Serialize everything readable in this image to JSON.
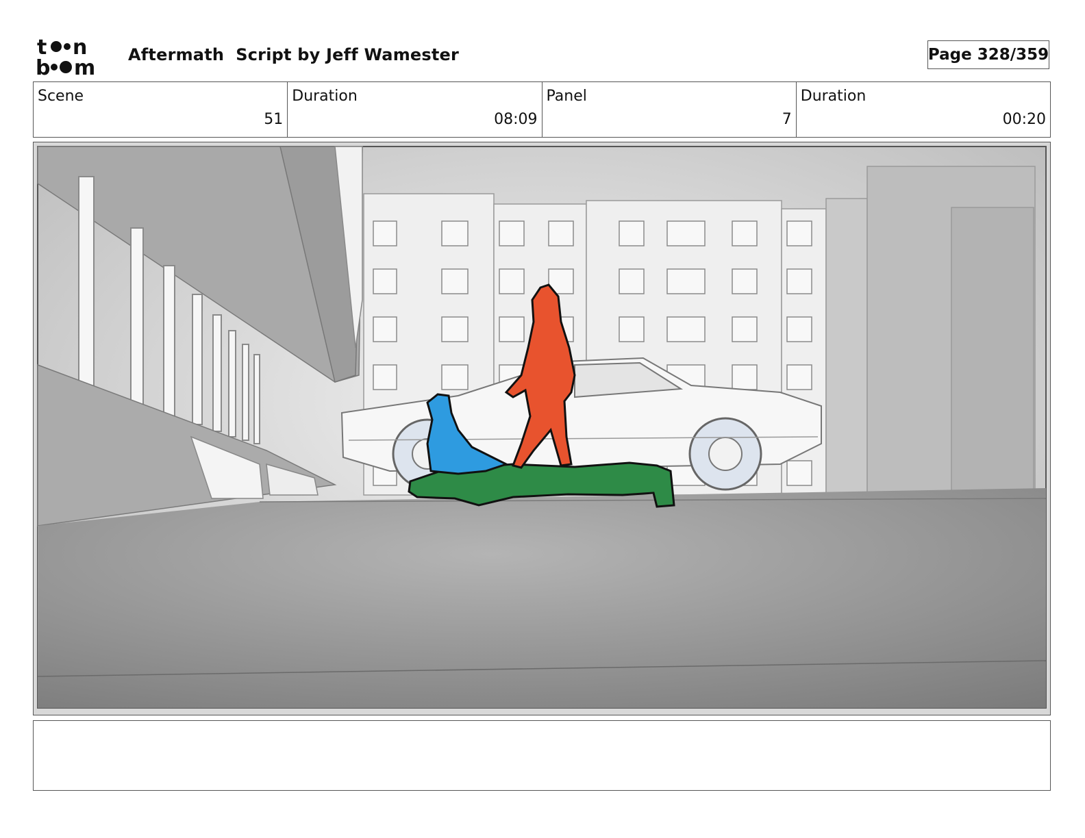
{
  "header": {
    "logo_name": "toonboom-logo",
    "title": "Aftermath  Script by Jeff Wamester",
    "page_label": "Page 328/359"
  },
  "info": {
    "scene_label": "Scene",
    "scene_value": "51",
    "scene_duration_label": "Duration",
    "scene_duration_value": "08:09",
    "panel_label": "Panel",
    "panel_value": "7",
    "panel_duration_label": "Duration",
    "panel_duration_value": "00:20"
  },
  "colors": {
    "red_figure": "#E8532E",
    "blue_figure": "#2E9BE0",
    "green_figure": "#2E8B47",
    "ground": "#9E9E9E",
    "sky": "#E2E2E2"
  },
  "notes": {
    "text": ""
  }
}
